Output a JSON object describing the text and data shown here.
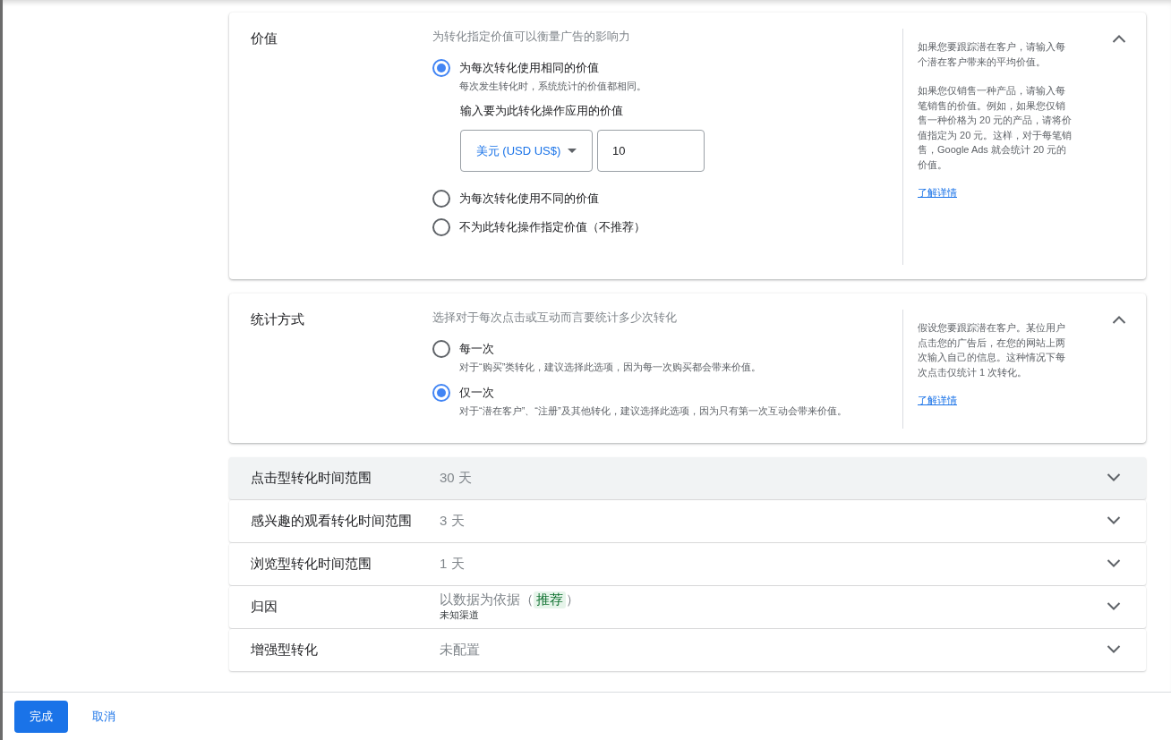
{
  "sections": [
    {
      "title": "价值",
      "expanded": true,
      "description": "为转化指定价值可以衡量广告的影响力",
      "options": [
        {
          "label": "为每次转化使用相同的价值",
          "hint": "每次发生转化时，系统统计的价值都相同。",
          "selected": true,
          "value_input": {
            "label": "输入要为此转化操作应用的价值",
            "currency": "美元 (USD US$)",
            "amount": "10"
          }
        },
        {
          "label": "为每次转化使用不同的价值",
          "selected": false
        },
        {
          "label": "不为此转化操作指定价值（不推荐）",
          "selected": false
        }
      ],
      "help": {
        "paragraphs": [
          "如果您要跟踪潜在客户，请输入每个潜在客户带来的平均价值。",
          "如果您仅销售一种产品，请输入每笔销售的价值。例如，如果您仅销售一种价格为 20 元的产品，请将价值指定为 20 元。这样，对于每笔销售，Google Ads 就会统计 20 元的价值。"
        ],
        "link": "了解详情"
      }
    },
    {
      "title": "统计方式",
      "expanded": true,
      "description": "选择对于每次点击或互动而言要统计多少次转化",
      "options": [
        {
          "label": "每一次",
          "hint": "对于“购买”类转化，建议选择此选项，因为每一次购买都会带来价值。",
          "selected": false
        },
        {
          "label": "仅一次",
          "hint": "对于“潜在客户”、“注册”及其他转化，建议选择此选项，因为只有第一次互动会带来价值。",
          "selected": true
        }
      ],
      "help": {
        "paragraphs": [
          "假设您要跟踪潜在客户。某位用户点击您的广告后，在您的网站上两次输入自己的信息。这种情况下每次点击仅统计 1 次转化。"
        ],
        "link": "了解详情"
      }
    },
    {
      "title": "点击型转化时间范围",
      "expanded": false,
      "hovered": true,
      "value": "30 天"
    },
    {
      "title": "感兴趣的观看转化时间范围",
      "expanded": false,
      "hovered": false,
      "value": "3 天"
    },
    {
      "title": "浏览型转化时间范围",
      "expanded": false,
      "hovered": false,
      "value": "1 天"
    },
    {
      "title": "归因",
      "expanded": false,
      "hovered": false,
      "value": "以数据为依据（",
      "badge": "推荐",
      "value_end": "）",
      "subvalue": "未知渠道"
    },
    {
      "title": "增强型转化",
      "expanded": false,
      "hovered": false,
      "value": "未配置"
    }
  ],
  "footer": {
    "buttons": [
      {
        "label": "完成",
        "kind": "primary"
      },
      {
        "label": "取消",
        "kind": "text"
      }
    ]
  }
}
